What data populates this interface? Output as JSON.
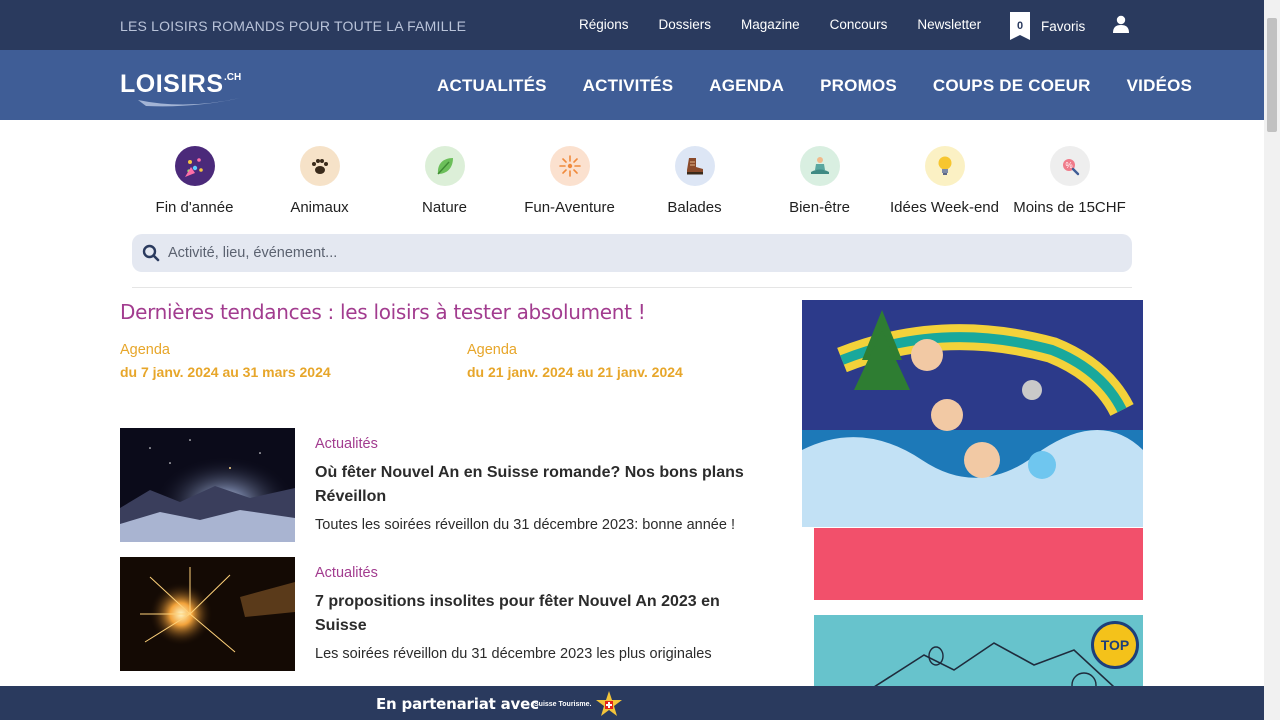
{
  "topbar": {
    "tagline": "LES LOISIRS ROMANDS POUR TOUTE LA FAMILLE",
    "links": [
      "Régions",
      "Dossiers",
      "Magazine",
      "Concours",
      "Newsletter"
    ],
    "favorites_count": "0",
    "favorites_label": "Favoris"
  },
  "nav": {
    "logo_text": "LOISIRS",
    "logo_sup": ".CH",
    "items": [
      "ACTUALITÉS",
      "ACTIVITÉS",
      "AGENDA",
      "PROMOS",
      "COUPS DE COEUR",
      "VIDÉOS"
    ]
  },
  "categories": [
    {
      "label": "Fin d'année",
      "icon": "party-icon",
      "bg": "#4b2a7a"
    },
    {
      "label": "Animaux",
      "icon": "paw-icon",
      "bg": "#f6e2c8"
    },
    {
      "label": "Nature",
      "icon": "leaf-icon",
      "bg": "#dcefd8"
    },
    {
      "label": "Fun-Aventure",
      "icon": "firework-icon",
      "bg": "#fbe1cf"
    },
    {
      "label": "Balades",
      "icon": "boot-icon",
      "bg": "#dde6f5"
    },
    {
      "label": "Bien-être",
      "icon": "meditation-icon",
      "bg": "#d9efe1"
    },
    {
      "label": "Idées Week-end",
      "icon": "lightbulb-icon",
      "bg": "#fbf1c4"
    },
    {
      "label": "Moins de 15CHF",
      "icon": "price-tag-icon",
      "bg": "#eeeeee"
    }
  ],
  "search": {
    "placeholder": "Activité, lieu, événement..."
  },
  "trends": {
    "title": "Dernières tendances : les loisirs à tester absolument !",
    "agenda": [
      {
        "category": "Agenda",
        "dates": "du 7 janv. 2024  au 31 mars 2024"
      },
      {
        "category": "Agenda",
        "dates": "du 21 janv. 2024  au 21 janv. 2024"
      }
    ]
  },
  "articles": [
    {
      "category": "Actualités",
      "title": "Où fêter Nouvel An en Suisse romande? Nos bons plans Réveillon",
      "description": "Toutes les soirées réveillon du 31 décembre 2023: bonne année !"
    },
    {
      "category": "Actualités",
      "title": "7 propositions insolites pour fêter Nouvel An 2023 en Suisse",
      "description": "Les soirées réveillon du 31 décembre 2023 les plus originales"
    }
  ],
  "ads": {
    "badge": "TOP"
  },
  "partner": {
    "label": "En partenariat avec",
    "name": "Suisse Tourisme."
  },
  "colors": {
    "topbar": "#2a3a5e",
    "nav": "#3f5d96",
    "accent_purple": "#a23c8f",
    "accent_orange": "#e7a62a"
  }
}
